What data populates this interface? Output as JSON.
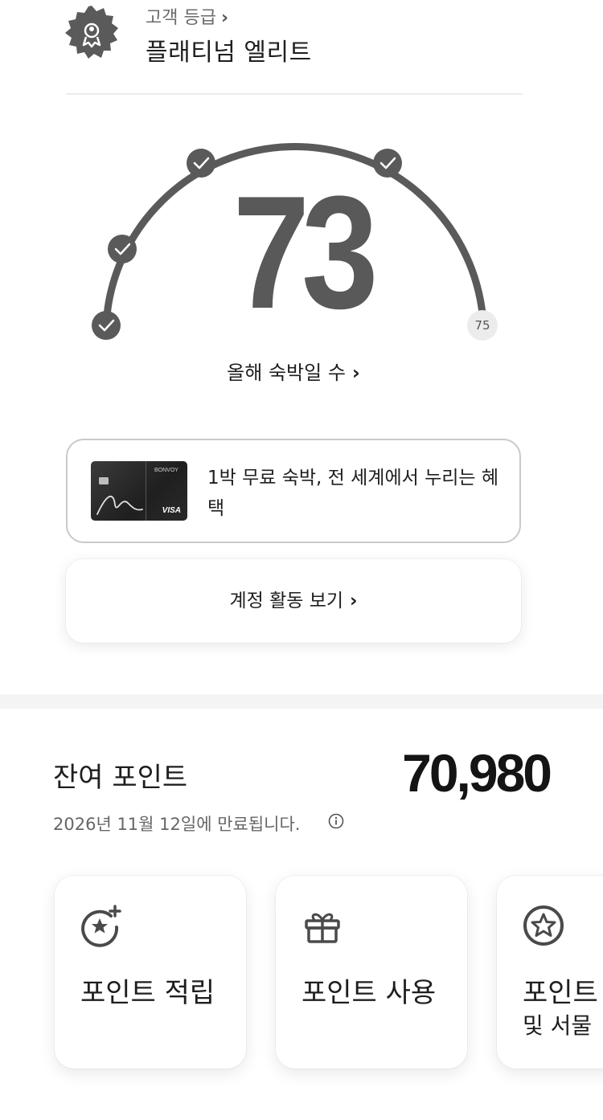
{
  "tier": {
    "label": "고객 등급",
    "chevron": "›",
    "name": "플래티넘 엘리트",
    "badge_icon": "award-ribbon-icon"
  },
  "nights": {
    "count": "73",
    "target": "75",
    "link_label": "올해 숙박일 수",
    "chevron": "›",
    "progress_fraction": 0.973,
    "milestones_completed": 4
  },
  "promo": {
    "text": "1박 무료 숙박, 전 세계에서 누리는 혜택",
    "card_logo": "BONVOY",
    "card_brand": "VISA"
  },
  "account": {
    "label": "계정 활동 보기",
    "chevron": "›"
  },
  "points": {
    "label": "잔여 포인트",
    "value": "70,980",
    "expiry": "2026년 11월 12일에 만료됩니다.",
    "info_icon": "info-icon"
  },
  "actions": [
    {
      "label": "포인트 적립",
      "icon": "star-plus-icon"
    },
    {
      "label": "포인트 사용",
      "icon": "gift-icon"
    },
    {
      "label": "포인트",
      "label_line2": "및 서물",
      "icon": "star-circle-icon"
    }
  ],
  "colors": {
    "gauge": "#5a5a5a",
    "text_primary": "#1e1e1e",
    "text_secondary": "#666666"
  }
}
